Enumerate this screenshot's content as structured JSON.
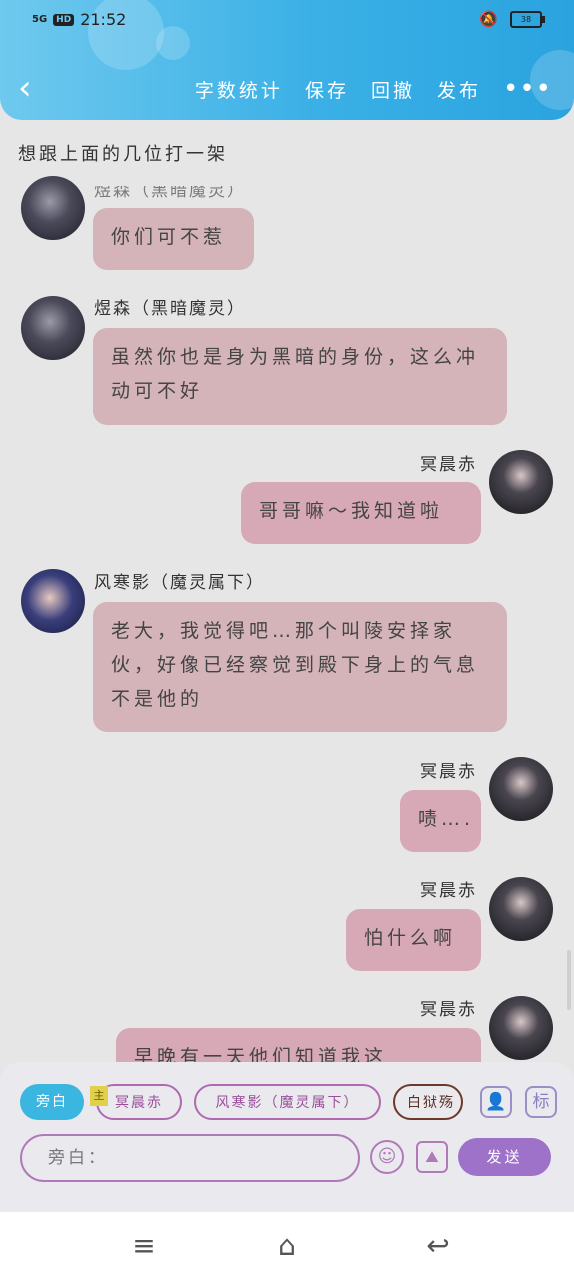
{
  "status_bar": {
    "network": "5G",
    "hd": "HD",
    "time": "21:52",
    "battery": "38"
  },
  "header": {
    "back_icon": "chevron-left-icon",
    "actions": {
      "word_count": "字数统计",
      "save": "保存",
      "rollback": "回撤",
      "publish": "发布"
    },
    "more_icon": "more-dots-icon"
  },
  "topic": "想跟上面的几位打一架",
  "messages": [
    {
      "side": "left",
      "name": "煜森（黑暗魔灵）",
      "text": "你们可不惹"
    },
    {
      "side": "left",
      "name": "煜森（黑暗魔灵）",
      "text": "虽然你也是身为黑暗的身份，这么冲动可不好"
    },
    {
      "side": "right",
      "name": "冥晨赤",
      "text": "哥哥嘛～我知道啦"
    },
    {
      "side": "left",
      "name": "风寒影（魔灵属下）",
      "text": "老大，我觉得吧…那个叫陵安择家伙，好像已经察觉到殿下身上的气息不是他的"
    },
    {
      "side": "right",
      "name": "冥晨赤",
      "text": "啧…."
    },
    {
      "side": "right",
      "name": "冥晨赤",
      "text": "怕什么啊"
    },
    {
      "side": "right",
      "name": "冥晨赤",
      "text": "早晚有一天他们知道我这"
    }
  ],
  "composer": {
    "aside_chip": "旁白",
    "main_tag": "主",
    "chips": [
      "冥晨赤",
      "风寒影（魔灵属下）",
      "白狱殇"
    ],
    "role_icon": "person-icon",
    "tag_icon": "标",
    "input_placeholder": "旁白：",
    "emoji_icon": "smiley-icon",
    "image_icon": "image-icon",
    "send_label": "发送"
  },
  "system_nav": {
    "menu_icon": "menu-icon",
    "home_icon": "home-icon",
    "back_icon": "return-icon"
  }
}
